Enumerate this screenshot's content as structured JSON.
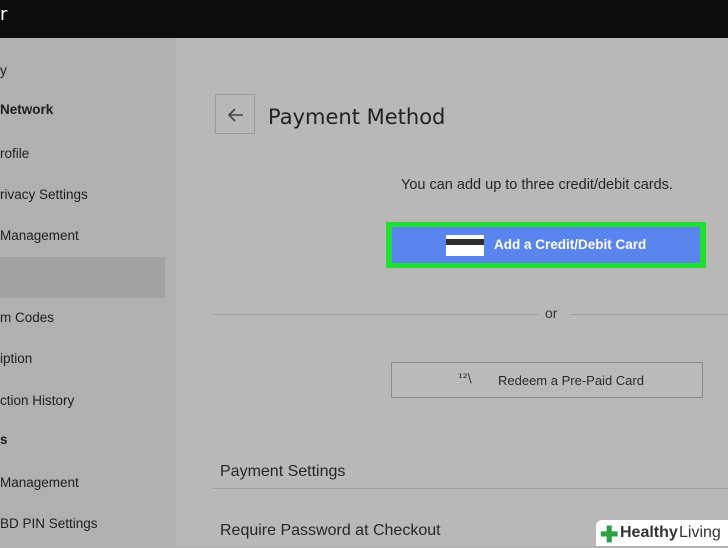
{
  "topbar": {
    "mark": "r"
  },
  "sidebar": {
    "items": [
      {
        "label": "y",
        "header": false
      },
      {
        "label": "Network",
        "header": true
      },
      {
        "label": "rofile",
        "header": false
      },
      {
        "label": "rivacy Settings",
        "header": false
      },
      {
        "label": "Management",
        "header": false
      },
      {
        "label": "",
        "header": false,
        "selected": true
      },
      {
        "label": "m Codes",
        "header": false
      },
      {
        "label": "iption",
        "header": false
      },
      {
        "label": "ction History",
        "header": false
      },
      {
        "label": "s",
        "header": true
      },
      {
        "label": "Management",
        "header": false
      },
      {
        "label": "BD PIN Settings",
        "header": false
      }
    ]
  },
  "main": {
    "back_icon": "arrow-left-icon",
    "title": "Payment Method",
    "info": "You can add up to three credit/debit cards.",
    "add_card": {
      "label": "Add a Credit/Debit Card",
      "icon": "credit-card-icon",
      "color": "#5b85ee",
      "highlight": "#1fe02f"
    },
    "separator": "or",
    "redeem": {
      "label": "Redeem a Pre-Paid Card",
      "icon": "prepaid-card-icon",
      "icon_text": "¹²\\"
    },
    "payment_settings": "Payment Settings",
    "require_password": "Require Password at Checkout"
  },
  "watermark": {
    "brand_bold": "Healthy",
    "brand_light": "Living"
  }
}
